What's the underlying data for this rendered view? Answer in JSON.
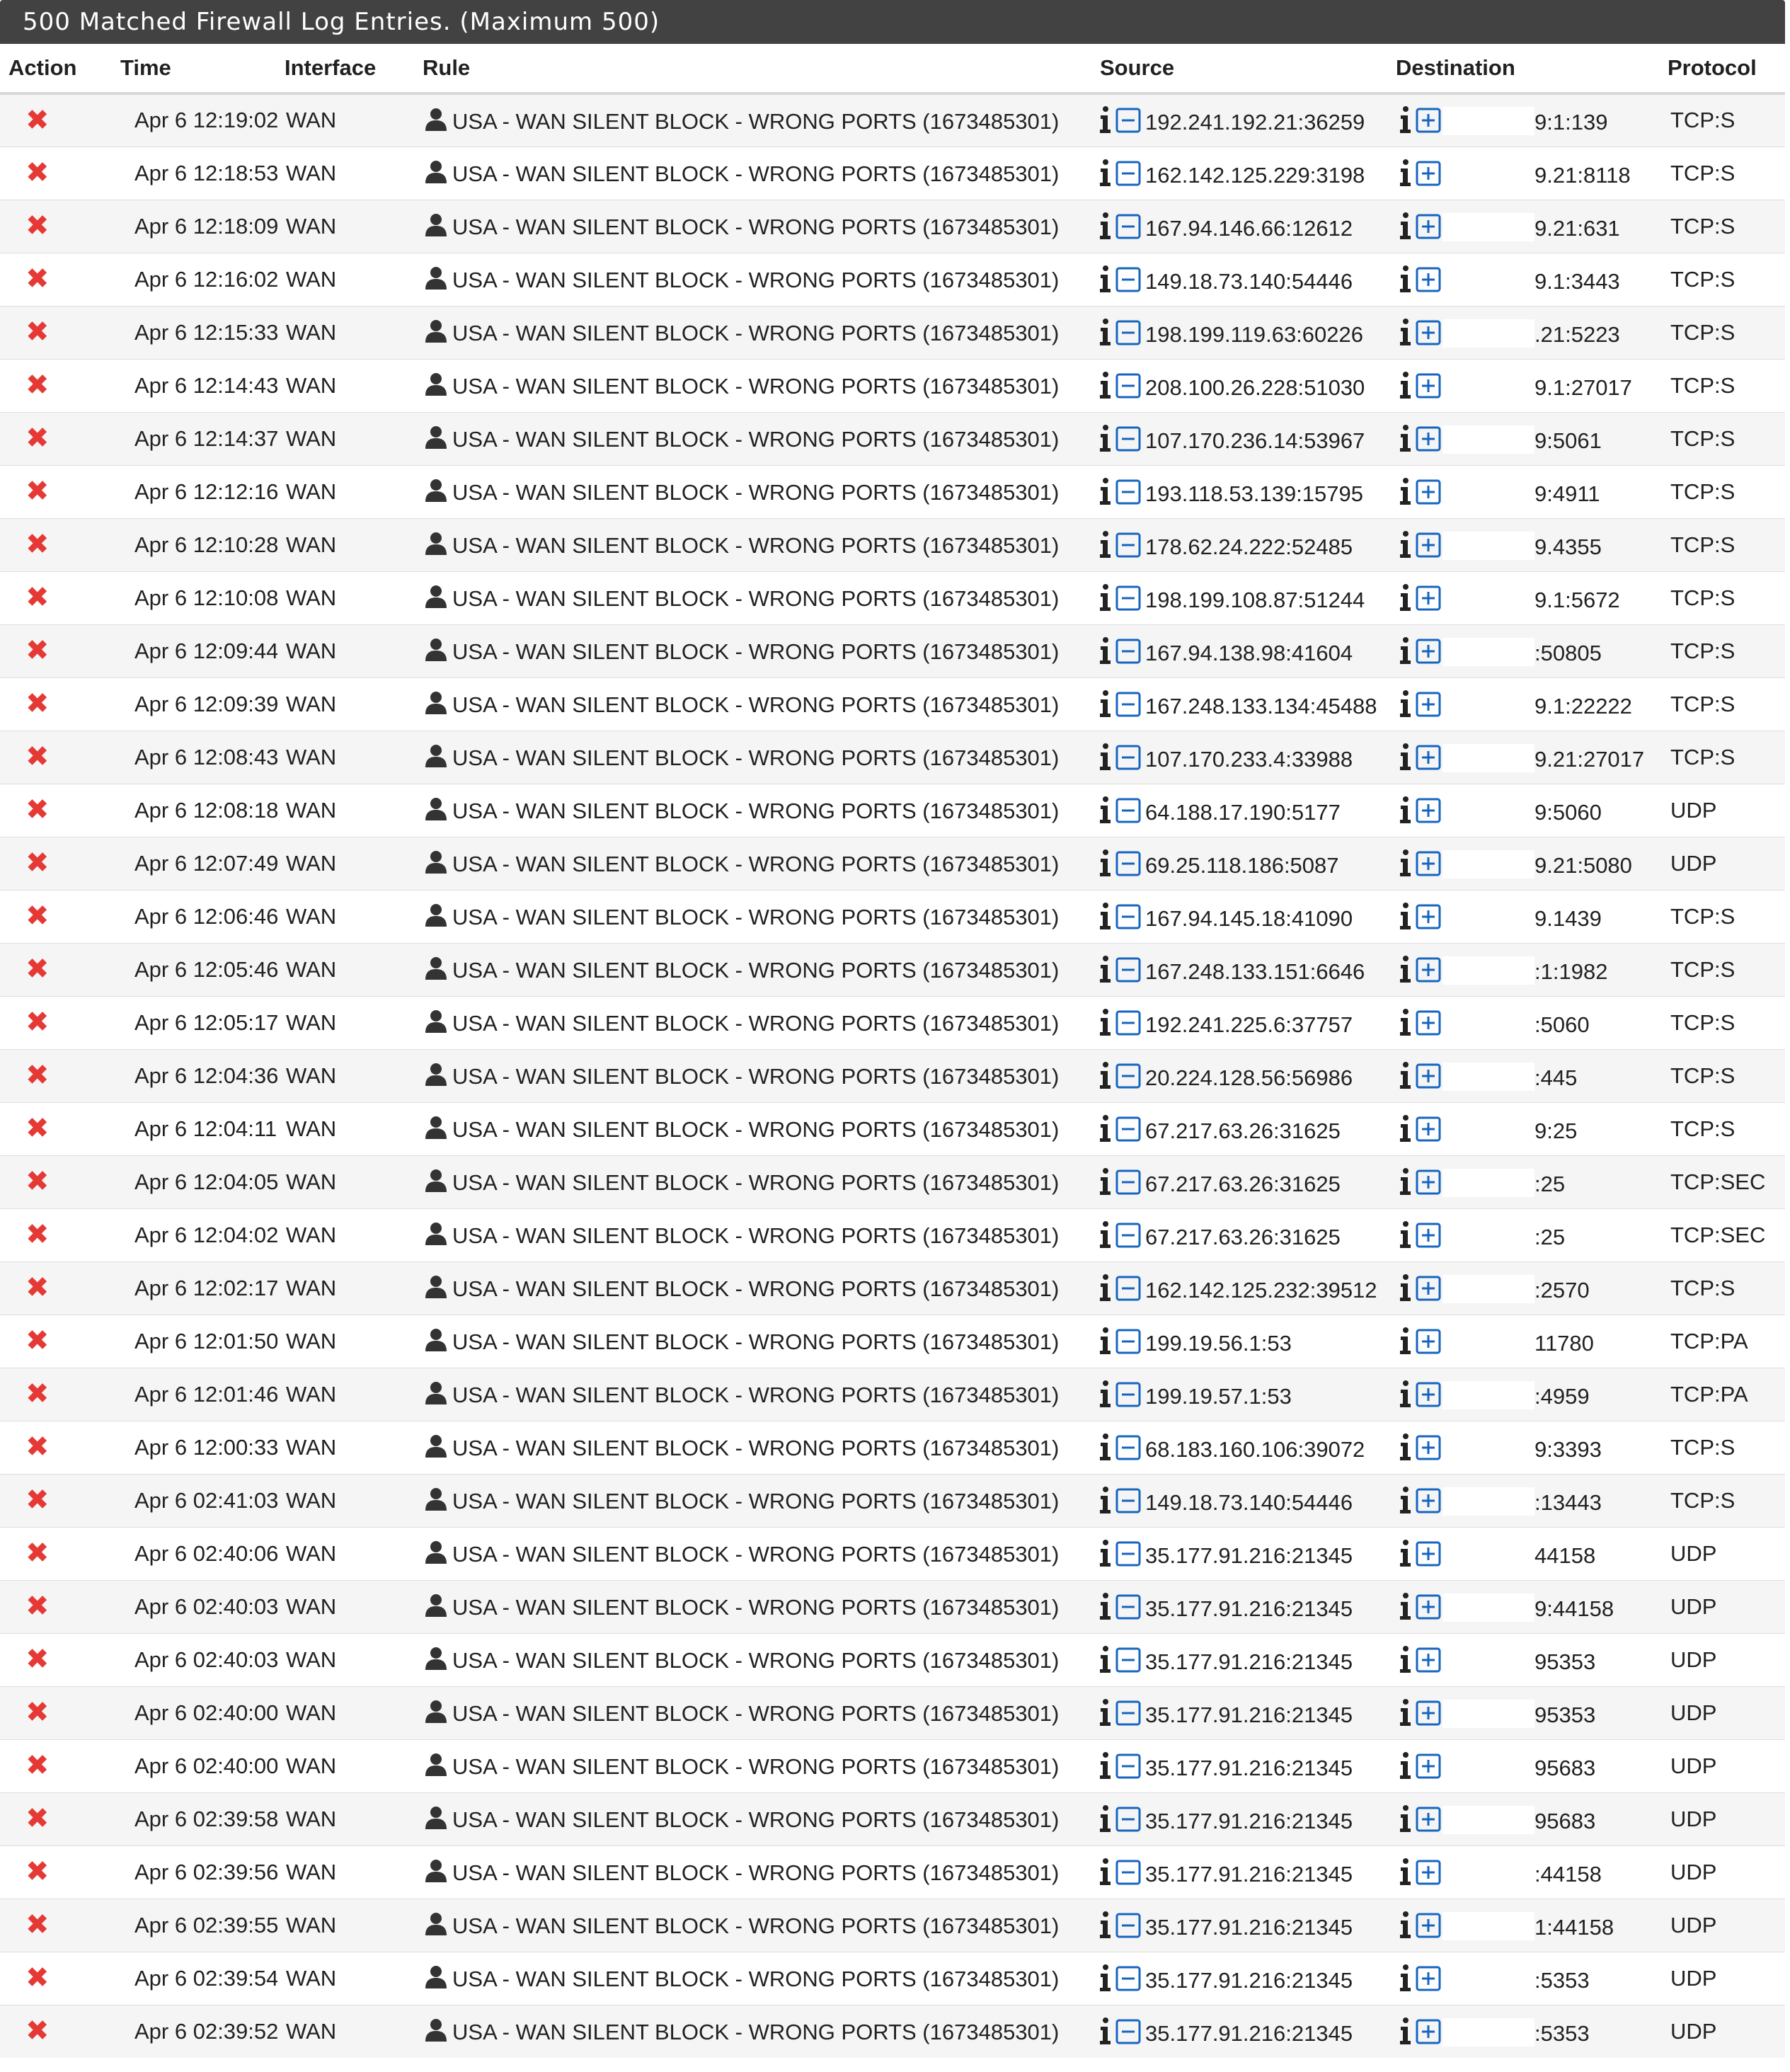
{
  "panel": {
    "title": "500 Matched Firewall Log Entries. (Maximum 500)"
  },
  "headers": {
    "action": "Action",
    "time": "Time",
    "interface": "Interface",
    "rule": "Rule",
    "source": "Source",
    "destination": "Destination",
    "protocol": "Protocol"
  },
  "icons": {
    "action": "block-x-icon",
    "rule": "user-icon",
    "source_info": "info-icon",
    "source_toggle": "minus-square-icon",
    "destination_info": "info-icon",
    "destination_toggle": "plus-square-icon",
    "block_color": "#e53935",
    "link_color": "#1565c0"
  },
  "rows": [
    {
      "time": "Apr 6 12:19:02",
      "iface": "WAN",
      "rule": "USA - WAN SILENT BLOCK - WRONG PORTS (1673485301)",
      "src": "192.241.192.21:36259",
      "dst": "9:1:139",
      "proto": "TCP:S"
    },
    {
      "time": "Apr 6 12:18:53",
      "iface": "WAN",
      "rule": "USA - WAN SILENT BLOCK - WRONG PORTS (1673485301)",
      "src": "162.142.125.229:3198",
      "dst": "9.21:8118",
      "proto": "TCP:S"
    },
    {
      "time": "Apr 6 12:18:09",
      "iface": "WAN",
      "rule": "USA - WAN SILENT BLOCK - WRONG PORTS (1673485301)",
      "src": "167.94.146.66:12612",
      "dst": "9.21:631",
      "proto": "TCP:S"
    },
    {
      "time": "Apr 6 12:16:02",
      "iface": "WAN",
      "rule": "USA - WAN SILENT BLOCK - WRONG PORTS (1673485301)",
      "src": "149.18.73.140:54446",
      "dst": "9.1:3443",
      "proto": "TCP:S"
    },
    {
      "time": "Apr 6 12:15:33",
      "iface": "WAN",
      "rule": "USA - WAN SILENT BLOCK - WRONG PORTS (1673485301)",
      "src": "198.199.119.63:60226",
      "dst": ".21:5223",
      "proto": "TCP:S"
    },
    {
      "time": "Apr 6 12:14:43",
      "iface": "WAN",
      "rule": "USA - WAN SILENT BLOCK - WRONG PORTS (1673485301)",
      "src": "208.100.26.228:51030",
      "dst": "9.1:27017",
      "proto": "TCP:S"
    },
    {
      "time": "Apr 6 12:14:37",
      "iface": "WAN",
      "rule": "USA - WAN SILENT BLOCK - WRONG PORTS (1673485301)",
      "src": "107.170.236.14:53967",
      "dst": "9:5061",
      "proto": "TCP:S"
    },
    {
      "time": "Apr 6 12:12:16",
      "iface": "WAN",
      "rule": "USA - WAN SILENT BLOCK - WRONG PORTS (1673485301)",
      "src": "193.118.53.139:15795",
      "dst": "9:4911",
      "proto": "TCP:S"
    },
    {
      "time": "Apr 6 12:10:28",
      "iface": "WAN",
      "rule": "USA - WAN SILENT BLOCK - WRONG PORTS (1673485301)",
      "src": "178.62.24.222:52485",
      "dst": "9.4355",
      "proto": "TCP:S"
    },
    {
      "time": "Apr 6 12:10:08",
      "iface": "WAN",
      "rule": "USA - WAN SILENT BLOCK - WRONG PORTS (1673485301)",
      "src": "198.199.108.87:51244",
      "dst": "9.1:5672",
      "proto": "TCP:S"
    },
    {
      "time": "Apr 6 12:09:44",
      "iface": "WAN",
      "rule": "USA - WAN SILENT BLOCK - WRONG PORTS (1673485301)",
      "src": "167.94.138.98:41604",
      "dst": ":50805",
      "proto": "TCP:S"
    },
    {
      "time": "Apr 6 12:09:39",
      "iface": "WAN",
      "rule": "USA - WAN SILENT BLOCK - WRONG PORTS (1673485301)",
      "src": "167.248.133.134:45488",
      "dst": "9.1:22222",
      "proto": "TCP:S"
    },
    {
      "time": "Apr 6 12:08:43",
      "iface": "WAN",
      "rule": "USA - WAN SILENT BLOCK - WRONG PORTS (1673485301)",
      "src": "107.170.233.4:33988",
      "dst": "9.21:27017",
      "proto": "TCP:S"
    },
    {
      "time": "Apr 6 12:08:18",
      "iface": "WAN",
      "rule": "USA - WAN SILENT BLOCK - WRONG PORTS (1673485301)",
      "src": "64.188.17.190:5177",
      "dst": "9:5060",
      "proto": "UDP"
    },
    {
      "time": "Apr 6 12:07:49",
      "iface": "WAN",
      "rule": "USA - WAN SILENT BLOCK - WRONG PORTS (1673485301)",
      "src": "69.25.118.186:5087",
      "dst": "9.21:5080",
      "proto": "UDP"
    },
    {
      "time": "Apr 6 12:06:46",
      "iface": "WAN",
      "rule": "USA - WAN SILENT BLOCK - WRONG PORTS (1673485301)",
      "src": "167.94.145.18:41090",
      "dst": "9.1439",
      "proto": "TCP:S"
    },
    {
      "time": "Apr 6 12:05:46",
      "iface": "WAN",
      "rule": "USA - WAN SILENT BLOCK - WRONG PORTS (1673485301)",
      "src": "167.248.133.151:6646",
      "dst": ":1:1982",
      "proto": "TCP:S"
    },
    {
      "time": "Apr 6 12:05:17",
      "iface": "WAN",
      "rule": "USA - WAN SILENT BLOCK - WRONG PORTS (1673485301)",
      "src": "192.241.225.6:37757",
      "dst": ":5060",
      "proto": "TCP:S"
    },
    {
      "time": "Apr 6 12:04:36",
      "iface": "WAN",
      "rule": "USA - WAN SILENT BLOCK - WRONG PORTS (1673485301)",
      "src": "20.224.128.56:56986",
      "dst": ":445",
      "proto": "TCP:S"
    },
    {
      "time": "Apr 6 12:04:11",
      "iface": "WAN",
      "rule": "USA - WAN SILENT BLOCK - WRONG PORTS (1673485301)",
      "src": "67.217.63.26:31625",
      "dst": "9:25",
      "proto": "TCP:S"
    },
    {
      "time": "Apr 6 12:04:05",
      "iface": "WAN",
      "rule": "USA - WAN SILENT BLOCK - WRONG PORTS (1673485301)",
      "src": "67.217.63.26:31625",
      "dst": ":25",
      "proto": "TCP:SEC"
    },
    {
      "time": "Apr 6 12:04:02",
      "iface": "WAN",
      "rule": "USA - WAN SILENT BLOCK - WRONG PORTS (1673485301)",
      "src": "67.217.63.26:31625",
      "dst": ":25",
      "proto": "TCP:SEC"
    },
    {
      "time": "Apr 6 12:02:17",
      "iface": "WAN",
      "rule": "USA - WAN SILENT BLOCK - WRONG PORTS (1673485301)",
      "src": "162.142.125.232:39512",
      "dst": ":2570",
      "proto": "TCP:S"
    },
    {
      "time": "Apr 6 12:01:50",
      "iface": "WAN",
      "rule": "USA - WAN SILENT BLOCK - WRONG PORTS (1673485301)",
      "src": "199.19.56.1:53",
      "dst": "11780",
      "proto": "TCP:PA"
    },
    {
      "time": "Apr 6 12:01:46",
      "iface": "WAN",
      "rule": "USA - WAN SILENT BLOCK - WRONG PORTS (1673485301)",
      "src": "199.19.57.1:53",
      "dst": ":4959",
      "proto": "TCP:PA"
    },
    {
      "time": "Apr 6 12:00:33",
      "iface": "WAN",
      "rule": "USA - WAN SILENT BLOCK - WRONG PORTS (1673485301)",
      "src": "68.183.160.106:39072",
      "dst": "9:3393",
      "proto": "TCP:S"
    },
    {
      "time": "Apr 6 02:41:03",
      "iface": "WAN",
      "rule": "USA - WAN SILENT BLOCK - WRONG PORTS (1673485301)",
      "src": "149.18.73.140:54446",
      "dst": ":13443",
      "proto": "TCP:S"
    },
    {
      "time": "Apr 6 02:40:06",
      "iface": "WAN",
      "rule": "USA - WAN SILENT BLOCK - WRONG PORTS (1673485301)",
      "src": "35.177.91.216:21345",
      "dst": "44158",
      "proto": "UDP"
    },
    {
      "time": "Apr 6 02:40:03",
      "iface": "WAN",
      "rule": "USA - WAN SILENT BLOCK - WRONG PORTS (1673485301)",
      "src": "35.177.91.216:21345",
      "dst": "9:44158",
      "proto": "UDP"
    },
    {
      "time": "Apr 6 02:40:03",
      "iface": "WAN",
      "rule": "USA - WAN SILENT BLOCK - WRONG PORTS (1673485301)",
      "src": "35.177.91.216:21345",
      "dst": "95353",
      "proto": "UDP"
    },
    {
      "time": "Apr 6 02:40:00",
      "iface": "WAN",
      "rule": "USA - WAN SILENT BLOCK - WRONG PORTS (1673485301)",
      "src": "35.177.91.216:21345",
      "dst": "95353",
      "proto": "UDP"
    },
    {
      "time": "Apr 6 02:40:00",
      "iface": "WAN",
      "rule": "USA - WAN SILENT BLOCK - WRONG PORTS (1673485301)",
      "src": "35.177.91.216:21345",
      "dst": "95683",
      "proto": "UDP"
    },
    {
      "time": "Apr 6 02:39:58",
      "iface": "WAN",
      "rule": "USA - WAN SILENT BLOCK - WRONG PORTS (1673485301)",
      "src": "35.177.91.216:21345",
      "dst": "95683",
      "proto": "UDP"
    },
    {
      "time": "Apr 6 02:39:56",
      "iface": "WAN",
      "rule": "USA - WAN SILENT BLOCK - WRONG PORTS (1673485301)",
      "src": "35.177.91.216:21345",
      "dst": ":44158",
      "proto": "UDP"
    },
    {
      "time": "Apr 6 02:39:55",
      "iface": "WAN",
      "rule": "USA - WAN SILENT BLOCK - WRONG PORTS (1673485301)",
      "src": "35.177.91.216:21345",
      "dst": "1:44158",
      "proto": "UDP"
    },
    {
      "time": "Apr 6 02:39:54",
      "iface": "WAN",
      "rule": "USA - WAN SILENT BLOCK - WRONG PORTS (1673485301)",
      "src": "35.177.91.216:21345",
      "dst": ":5353",
      "proto": "UDP"
    },
    {
      "time": "Apr 6 02:39:52",
      "iface": "WAN",
      "rule": "USA - WAN SILENT BLOCK - WRONG PORTS (1673485301)",
      "src": "35.177.91.216:21345",
      "dst": ":5353",
      "proto": "UDP"
    }
  ]
}
